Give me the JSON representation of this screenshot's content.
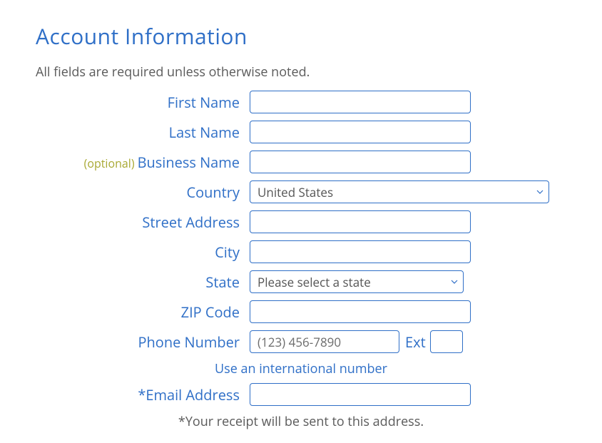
{
  "title": "Account Information",
  "subtitle": "All fields are required unless otherwise noted.",
  "optional_prefix": "(optional)",
  "fields": {
    "first_name": {
      "label": "First Name",
      "value": ""
    },
    "last_name": {
      "label": "Last Name",
      "value": ""
    },
    "business_name": {
      "label": "Business Name",
      "value": ""
    },
    "country": {
      "label": "Country",
      "selected": "United States"
    },
    "street": {
      "label": "Street Address",
      "value": ""
    },
    "city": {
      "label": "City",
      "value": ""
    },
    "state": {
      "label": "State",
      "selected": "Please select a state"
    },
    "zip": {
      "label": "ZIP Code",
      "value": ""
    },
    "phone": {
      "label": "Phone Number",
      "placeholder": "(123) 456-7890",
      "value": ""
    },
    "ext": {
      "label": "Ext",
      "value": ""
    },
    "email": {
      "label": "*Email Address",
      "value": ""
    }
  },
  "intl_link": "Use an international number",
  "receipt_note": "*Your receipt will be sent to this address."
}
